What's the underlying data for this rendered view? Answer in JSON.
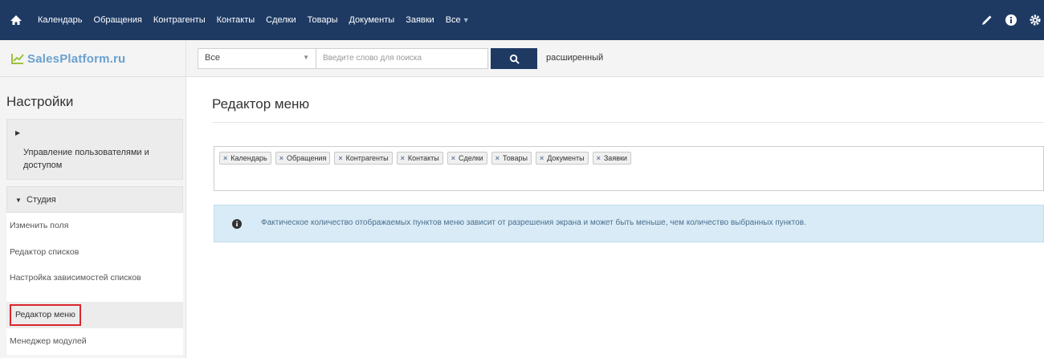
{
  "topnav": {
    "items": [
      {
        "label": "Календарь"
      },
      {
        "label": "Обращения"
      },
      {
        "label": "Контрагенты"
      },
      {
        "label": "Контакты"
      },
      {
        "label": "Сделки"
      },
      {
        "label": "Товары"
      },
      {
        "label": "Документы"
      },
      {
        "label": "Заявки"
      },
      {
        "label": "Все"
      }
    ],
    "right_icons": [
      "pencil-icon",
      "info-icon",
      "gear-icon"
    ]
  },
  "header": {
    "logo_text": "SalesPlatform.ru",
    "search_module": "Все",
    "search_placeholder": "Введите слово для поиска",
    "advanced_link": "расширенный"
  },
  "sidebar": {
    "title": "Настройки",
    "section_users": "Управление пользователями и доступом",
    "section_studio": "Студия",
    "items": [
      {
        "label": "Изменить поля"
      },
      {
        "label": "Редактор списков"
      },
      {
        "label": "Настройка зависимостей списков"
      },
      {
        "label": "Редактор меню",
        "active": true
      },
      {
        "label": "Менеджер модулей"
      }
    ]
  },
  "main": {
    "title": "Редактор меню",
    "tags": [
      {
        "label": "Календарь"
      },
      {
        "label": "Обращения"
      },
      {
        "label": "Контрагенты"
      },
      {
        "label": "Контакты"
      },
      {
        "label": "Сделки"
      },
      {
        "label": "Товары"
      },
      {
        "label": "Документы"
      },
      {
        "label": "Заявки"
      }
    ],
    "info_text": "Фактическое количество отображаемых пунктов меню зависит от разрешения экрана и может быть меньше, чем количество выбранных пунктов."
  },
  "colors": {
    "topnav_bg": "#1e3a63",
    "logo": "#6aa0cf",
    "highlight": "#d9272d",
    "info_bg": "#d9ebf6"
  }
}
